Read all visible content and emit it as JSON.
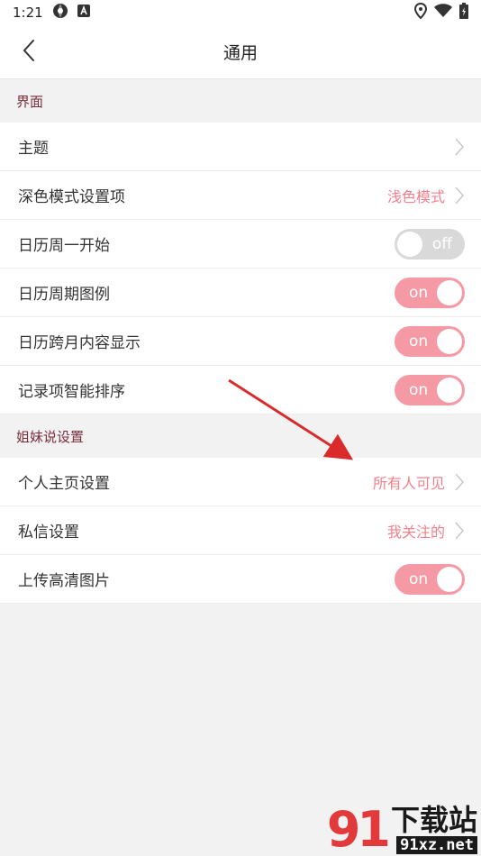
{
  "status_bar": {
    "time": "1:21",
    "left_icons": [
      "aperture-icon",
      "app-a-icon"
    ],
    "right_icons": [
      "location-icon",
      "wifi-icon",
      "battery-icon"
    ]
  },
  "header": {
    "title": "通用",
    "back_icon": "chevron-left-icon"
  },
  "sections": [
    {
      "title": "界面",
      "items": [
        {
          "label": "主题",
          "type": "link",
          "value": ""
        },
        {
          "label": "深色模式设置项",
          "type": "link",
          "value": "浅色模式"
        },
        {
          "label": "日历周一开始",
          "type": "toggle",
          "state": "off",
          "state_label": "off"
        },
        {
          "label": "日历周期图例",
          "type": "toggle",
          "state": "on",
          "state_label": "on"
        },
        {
          "label": "日历跨月内容显示",
          "type": "toggle",
          "state": "on",
          "state_label": "on"
        },
        {
          "label": "记录项智能排序",
          "type": "toggle",
          "state": "on",
          "state_label": "on"
        }
      ]
    },
    {
      "title": "姐妹说设置",
      "items": [
        {
          "label": "个人主页设置",
          "type": "link",
          "value": "所有人可见"
        },
        {
          "label": "私信设置",
          "type": "link",
          "value": "我关注的"
        },
        {
          "label": "上传高清图片",
          "type": "toggle",
          "state": "on",
          "state_label": "on"
        }
      ]
    }
  ],
  "colors": {
    "accent": "#f59aa5",
    "value_text": "#f27f8c",
    "section_text": "#7a2e3c",
    "toggle_off": "#d9d9d9",
    "annotation_arrow": "#d92b2b"
  },
  "watermark": {
    "logo": "91",
    "title": "下载站",
    "url": "91xz.net"
  }
}
